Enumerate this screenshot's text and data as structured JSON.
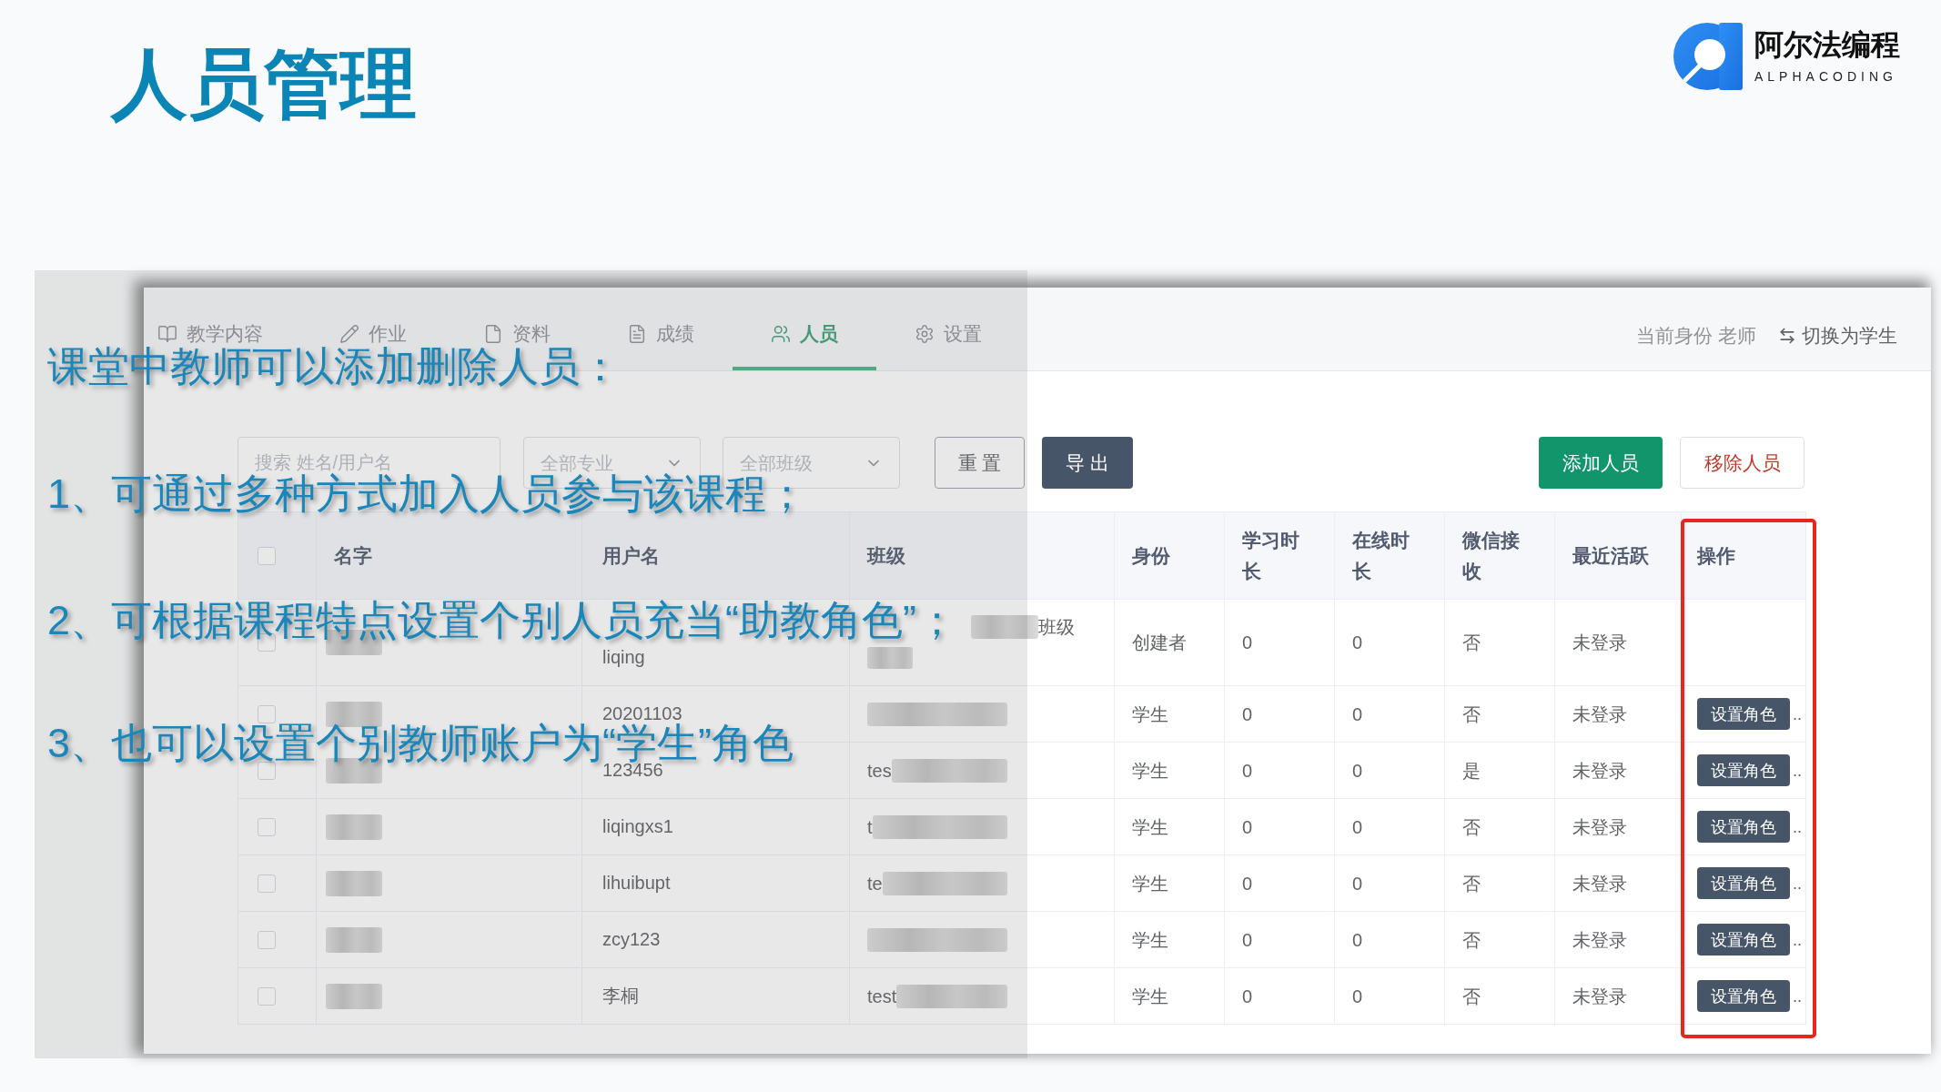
{
  "title": "人员管理",
  "logo": {
    "name": "阿尔法编程",
    "tagline": "ALPHACODING"
  },
  "annotation": {
    "intro": "课堂中教师可以添加删除人员：",
    "points": [
      "1、可通过多种方式加入人员参与该课程；",
      "2、可根据课程特点设置个别人员充当“助教角色”；",
      "3、也可以设置个别教师账户为“学生”角色"
    ]
  },
  "app": {
    "tabs": [
      {
        "label": "教学内容",
        "selected": false
      },
      {
        "label": "作业",
        "selected": false
      },
      {
        "label": "资料",
        "selected": false
      },
      {
        "label": "成绩",
        "selected": false
      },
      {
        "label": "人员",
        "selected": true
      },
      {
        "label": "设置",
        "selected": false
      }
    ],
    "identity": "当前身份 老师",
    "switch_link": "切换为学生",
    "search": {
      "placeholder": "搜索 姓名/用户名"
    },
    "filters": [
      {
        "placeholder": "全部专业"
      },
      {
        "placeholder": "全部班级"
      }
    ],
    "buttons": [
      {
        "label": "重 置",
        "kind": "outline"
      },
      {
        "label": "导 出",
        "kind": "dark"
      }
    ],
    "actions": [
      {
        "label": "添加人员",
        "kind": "primary"
      },
      {
        "label": "移除人员",
        "kind": "danger"
      }
    ],
    "table": {
      "select_all_checked": false,
      "columns": [
        {
          "label": "名字",
          "highlighted": false
        },
        {
          "label": "用户名",
          "highlighted": false
        },
        {
          "label": "班级",
          "highlighted": false
        },
        {
          "label": "身份",
          "highlighted": false
        },
        {
          "label": "学习时长",
          "highlighted": false
        },
        {
          "label": "在线时长",
          "highlighted": false
        },
        {
          "label": "微信接收",
          "highlighted": false
        },
        {
          "label": "最近活跃",
          "highlighted": false
        },
        {
          "label": "操作",
          "highlighted": true
        }
      ],
      "rows": [
        {
          "checked": false,
          "username": "liqing",
          "class": {
            "kind": "suffix",
            "text": "班级"
          },
          "role": "创建者",
          "study_time": "0",
          "online_time": "0",
          "wechat": "否",
          "last_active": "未登录"
        },
        {
          "checked": false,
          "username": "20201103",
          "class": {
            "kind": "hidden"
          },
          "role": "学生",
          "study_time": "0",
          "online_time": "0",
          "wechat": "否",
          "last_active": "未登录",
          "action": "设置角色",
          "more": ".."
        },
        {
          "checked": false,
          "username": "123456",
          "class": {
            "kind": "prefix",
            "text": "tes"
          },
          "role": "学生",
          "study_time": "0",
          "online_time": "0",
          "wechat": "是",
          "last_active": "未登录",
          "action": "设置角色",
          "more": ".."
        },
        {
          "checked": false,
          "username": "liqingxs1",
          "class": {
            "kind": "prefix",
            "text": "t"
          },
          "role": "学生",
          "study_time": "0",
          "online_time": "0",
          "wechat": "否",
          "last_active": "未登录",
          "action": "设置角色",
          "more": ".."
        },
        {
          "checked": false,
          "username": "lihuibupt",
          "class": {
            "kind": "prefix",
            "text": "te"
          },
          "role": "学生",
          "study_time": "0",
          "online_time": "0",
          "wechat": "否",
          "last_active": "未登录",
          "action": "设置角色",
          "more": ".."
        },
        {
          "checked": false,
          "username": "zcy123",
          "class": {
            "kind": "hidden"
          },
          "role": "学生",
          "study_time": "0",
          "online_time": "0",
          "wechat": "否",
          "last_active": "未登录",
          "action": "设置角色",
          "more": ".."
        },
        {
          "checked": false,
          "username": "李桐",
          "class": {
            "kind": "prefix",
            "text": "test"
          },
          "role": "学生",
          "study_time": "0",
          "online_time": "0",
          "wechat": "否",
          "last_active": "未登录",
          "action": "设置角色",
          "more": ".."
        }
      ]
    }
  }
}
